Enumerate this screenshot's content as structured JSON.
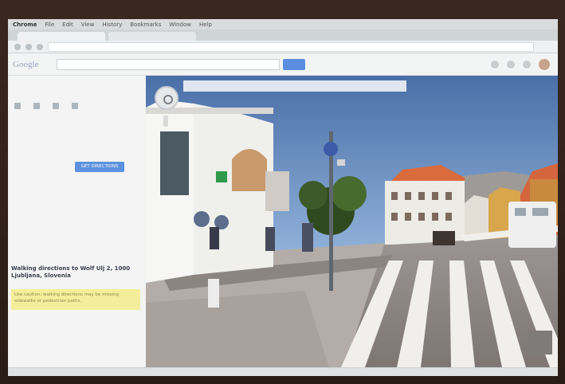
{
  "menubar": {
    "app": "Chrome",
    "items": [
      "File",
      "Edit",
      "View",
      "History",
      "Bookmarks",
      "Window",
      "Help"
    ],
    "status": ""
  },
  "tabs": [
    {
      "label": ""
    },
    {
      "label": ""
    }
  ],
  "urlbar": {
    "url": ""
  },
  "header": {
    "logo": "Google",
    "search": "",
    "search_btn": ""
  },
  "sidebar": {
    "directions_title": "Walking directions to Wolf Ulj 2, 1000 Ljubljana, Slovenia",
    "warning": "Use caution: walking directions may be missing sidewalks or pedestrian paths.",
    "get_directions": "GET DIRECTIONS"
  },
  "streetview": {
    "info": ""
  },
  "bottom": {
    "text": ""
  }
}
